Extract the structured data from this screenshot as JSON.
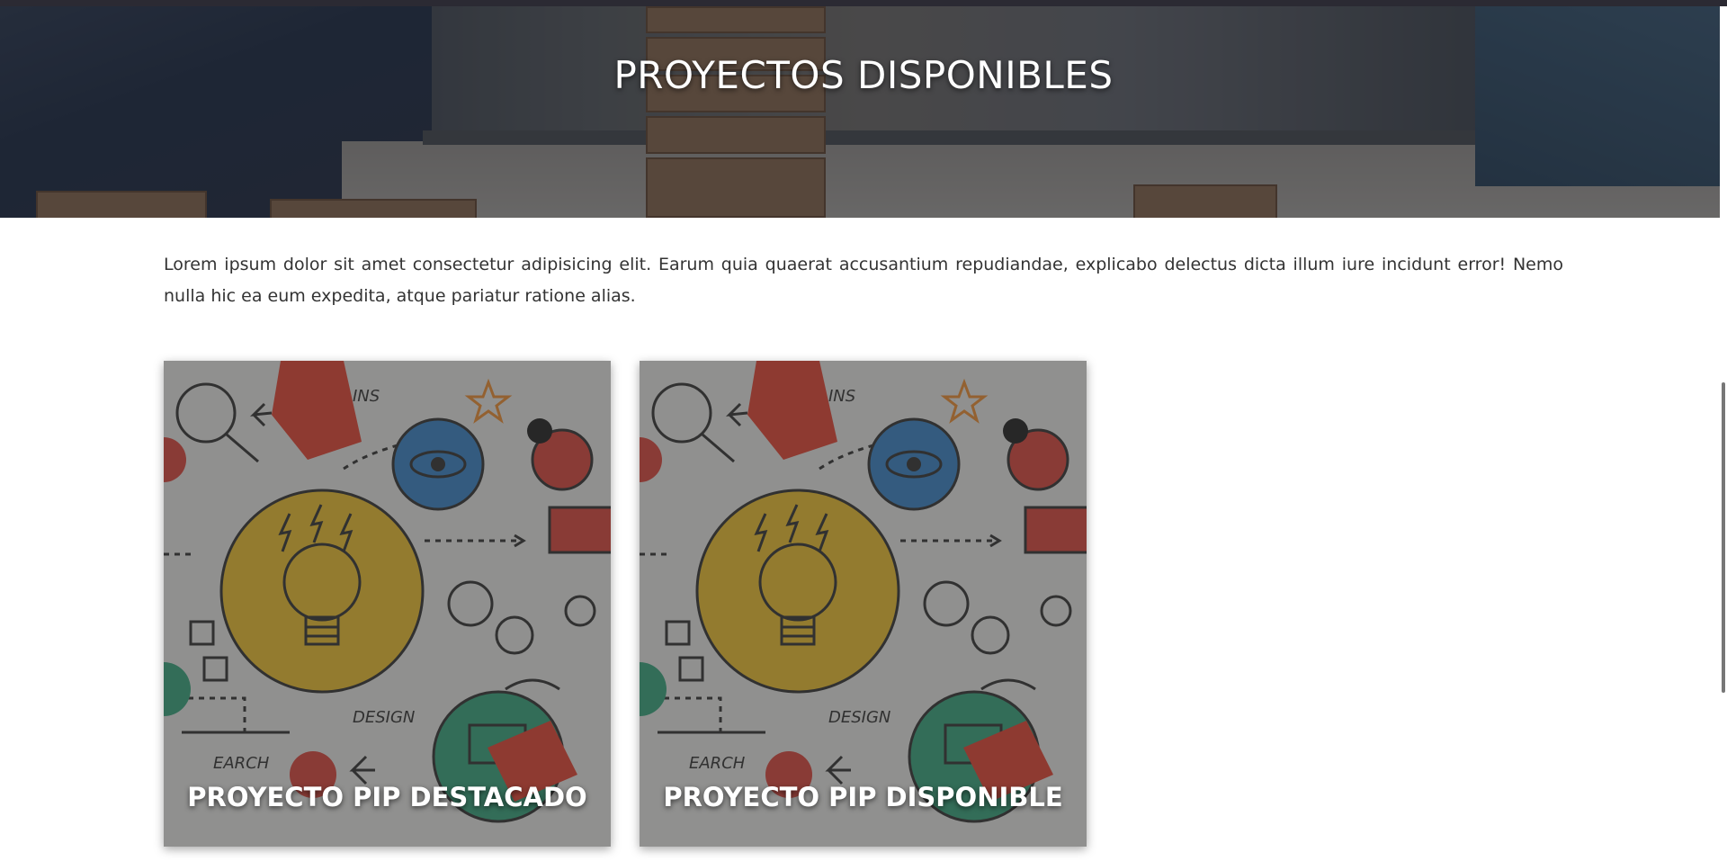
{
  "hero": {
    "title": "PROYECTOS DISPONIBLES"
  },
  "intro": {
    "text": "Lorem ipsum dolor sit amet consectetur adipisicing elit. Earum quia quaerat accusantium repudiandae, explicabo delectus dicta illum iure incidunt error! Nemo nulla hic ea eum expedita, atque pariatur ratione alias."
  },
  "cards": [
    {
      "title": "PROYECTO PIP DESTACADO",
      "image_words": [
        "INS",
        "DESIGN",
        "EARCH"
      ]
    },
    {
      "title": "PROYECTO PIP DISPONIBLE",
      "image_words": [
        "INS",
        "DESIGN",
        "EARCH"
      ]
    }
  ],
  "colors": {
    "page_background": "#ffffff",
    "body_text": "#333333",
    "title_text": "#ffffff",
    "top_bar": "#2b2a33",
    "bulb_yellow": "#c9a227",
    "eye_blue": "#2f6fa8",
    "monitor_green": "#2e8b6a",
    "accent_red": "#b93a32"
  }
}
